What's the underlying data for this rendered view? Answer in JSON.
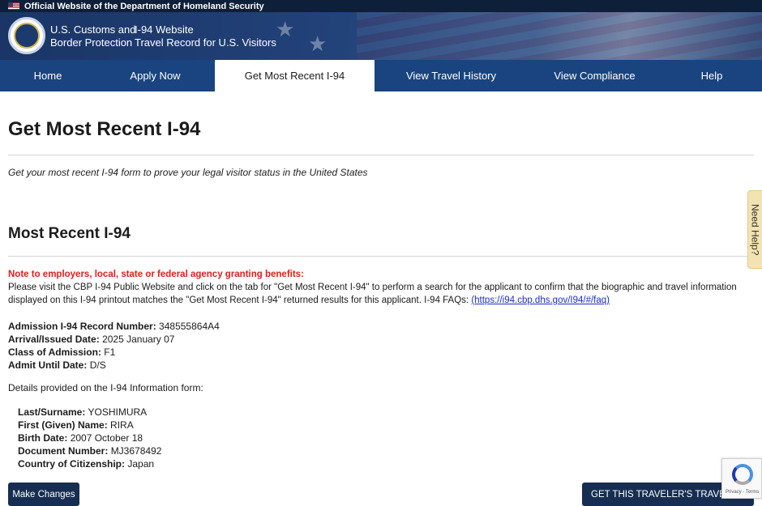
{
  "gov_banner": {
    "text": "Official Website of the Department of Homeland Security"
  },
  "header": {
    "agency_line1": "U.S. Customs and",
    "agency_line2": "Border Protection",
    "site_line1": "I-94 Website",
    "site_line2": "Travel Record for U.S. Visitors"
  },
  "nav": [
    {
      "label": "Home"
    },
    {
      "label": "Apply Now"
    },
    {
      "label": "Get Most Recent I-94"
    },
    {
      "label": "View Travel History"
    },
    {
      "label": "View Compliance"
    },
    {
      "label": "Help"
    }
  ],
  "page": {
    "title": "Get Most Recent I-94",
    "subtitle": "Get your most recent I-94 form to prove your legal visitor status in the United States",
    "section_title": "Most Recent I-94",
    "note_heading": "Note to employers, local, state or federal agency granting benefits:",
    "note_text": "Please visit the CBP I-94 Public Website and click on the tab for \"Get Most Recent I-94\" to perform a search for the applicant to confirm that the biographic and travel information displayed on this I-94 printout matches the \"Get Most Recent I-94\" returned results for this applicant. I-94 FAQs: ",
    "note_link": "(https://i94.cbp.dhs.gov/I94/#/faq)"
  },
  "record": {
    "admission_label": "Admission I-94 Record Number:",
    "admission_value": "348555864A4",
    "arrival_label": "Arrival/Issued Date:",
    "arrival_value": "2025 January 07",
    "class_label": "Class of Admission:",
    "class_value": "F1",
    "admit_label": "Admit Until Date:",
    "admit_value": "D/S"
  },
  "details": {
    "intro": "Details provided on the I-94 Information form:",
    "last_label": "Last/Surname:",
    "last_value": "YOSHIMURA",
    "first_label": "First (Given) Name:",
    "first_value": "RIRA",
    "birth_label": "Birth Date:",
    "birth_value": "2007 October 18",
    "doc_label": "Document Number:",
    "doc_value": "MJ3678492",
    "country_label": "Country of Citizenship:",
    "country_value": "Japan"
  },
  "buttons": {
    "make_changes": "Make Changes",
    "travel_history": "GET THIS TRAVELER'S TRAVEL HISTORY"
  },
  "side_tab": {
    "label": "Need Help?"
  },
  "recaptcha": {
    "text": "Privacy - Terms"
  },
  "colors": {
    "nav_bg": "#1a4480",
    "header_bg": "#1a3566",
    "note_red": "#e31c1c",
    "button_bg": "#162e51",
    "link": "#1a2fc0"
  }
}
